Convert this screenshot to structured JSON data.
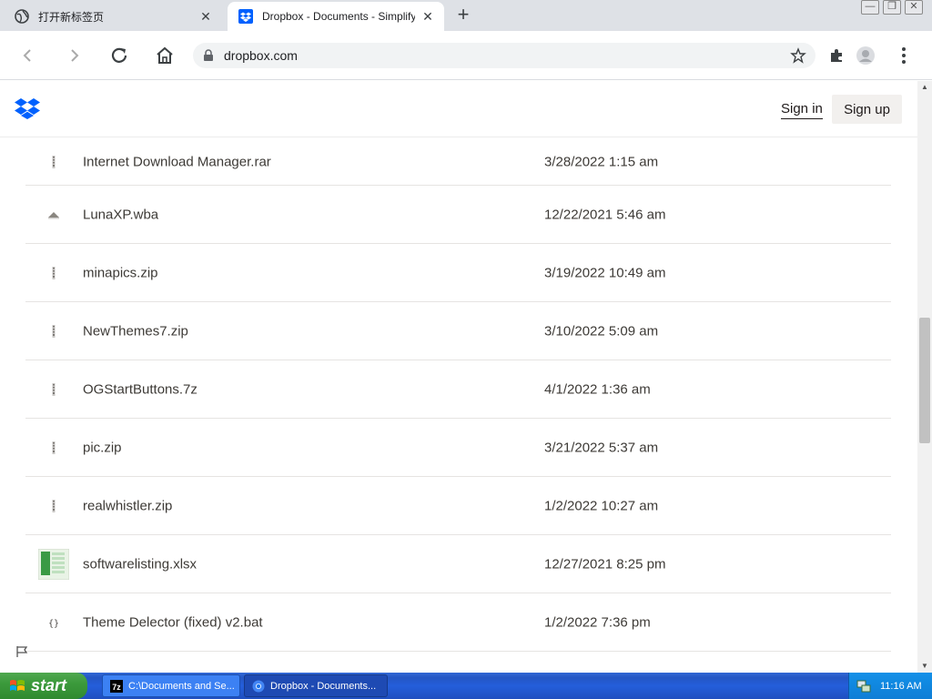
{
  "browser": {
    "tabs": [
      {
        "title": "打开新标签页",
        "active": false
      },
      {
        "title": "Dropbox - Documents - Simplify your",
        "active": true
      }
    ],
    "new_tab_label": "+",
    "url": "dropbox.com"
  },
  "site": {
    "sign_in": "Sign in",
    "sign_up": "Sign up",
    "accent": "#0061fe"
  },
  "files": [
    {
      "name": "Internet Download Manager.rar",
      "date": "3/28/2022 1:15 am",
      "icon": "archive-icon"
    },
    {
      "name": "LunaXP.wba",
      "date": "12/22/2021 5:46 am",
      "icon": "theme-file-icon"
    },
    {
      "name": "minapics.zip",
      "date": "3/19/2022 10:49 am",
      "icon": "archive-icon"
    },
    {
      "name": "NewThemes7.zip",
      "date": "3/10/2022 5:09 am",
      "icon": "archive-icon"
    },
    {
      "name": "OGStartButtons.7z",
      "date": "4/1/2022 1:36 am",
      "icon": "archive-icon"
    },
    {
      "name": "pic.zip",
      "date": "3/21/2022 5:37 am",
      "icon": "archive-icon"
    },
    {
      "name": "realwhistler.zip",
      "date": "1/2/2022 10:27 am",
      "icon": "archive-icon"
    },
    {
      "name": "softwarelisting.xlsx",
      "date": "12/27/2021 8:25 pm",
      "icon": "spreadsheet-icon"
    },
    {
      "name": "Theme Delector (fixed) v2.bat",
      "date": "1/2/2022 7:36 pm",
      "icon": "code-file-icon"
    }
  ],
  "taskbar": {
    "start_label": "start",
    "tasks": [
      {
        "label": "C:\\Documents and Se...",
        "icon": "7zip-icon"
      },
      {
        "label": "Dropbox - Documents...",
        "icon": "chrome-icon"
      }
    ],
    "clock": "11:16 AM"
  }
}
